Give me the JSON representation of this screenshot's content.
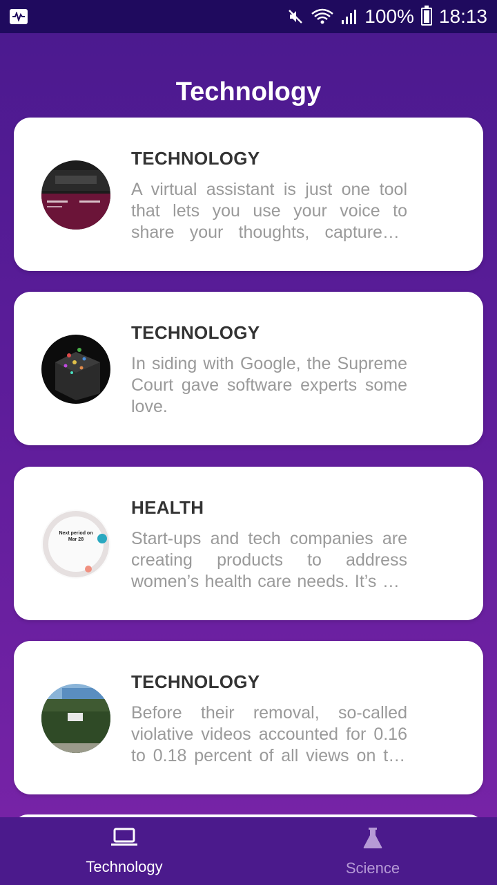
{
  "status_bar": {
    "battery_percent": "100%",
    "time": "18:13"
  },
  "page_title": "Technology",
  "articles": [
    {
      "category": "TECHNOLOGY",
      "description": "A virtual assistant is just one tool that lets you use your voice to share your thoughts, capture a moment, or take notes for later."
    },
    {
      "category": "TECHNOLOGY",
      "description": "In siding with Google, the Supreme Court gave software experts some love."
    },
    {
      "category": "HEALTH",
      "description": "Start-ups and tech companies are creating products to address women’s health care needs. It’s still early days."
    },
    {
      "category": "TECHNOLOGY",
      "description": "Before their removal, so-called violative videos accounted for 0.16 to 0.18 percent of all views on the platform."
    }
  ],
  "thumb_text": {
    "line1": "Next period on",
    "line2": "Mar 28"
  },
  "bottom_nav": {
    "technology_label": "Technology",
    "science_label": "Science"
  },
  "colors": {
    "accent": "#4b1a8c",
    "status_bar": "#1f0a5e",
    "inactive_nav": "#b69ad6"
  }
}
